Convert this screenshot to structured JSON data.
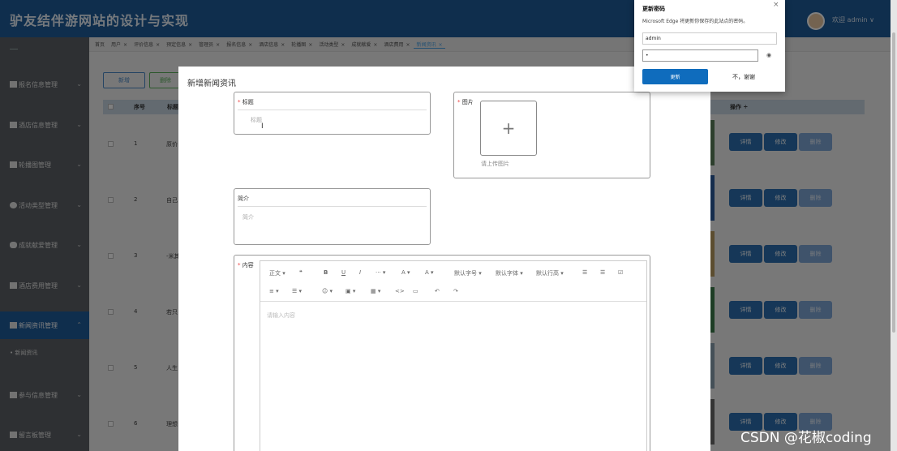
{
  "header": {
    "title": "驴友结伴游网站的设计与实现",
    "welcome": "欢迎 admin ∨"
  },
  "sidebar": {
    "items": [
      {
        "label": "报名信息管理"
      },
      {
        "label": "酒店信息管理"
      },
      {
        "label": "轮播图管理"
      },
      {
        "label": "活动类型管理"
      },
      {
        "label": "成就献爱管理"
      },
      {
        "label": "酒店费用管理"
      },
      {
        "label": "新闻资讯管理"
      },
      {
        "label": "参与信息管理"
      },
      {
        "label": "留言板管理"
      }
    ],
    "sub_item": "• 新闻资讯"
  },
  "tabs": [
    "首页",
    "用户",
    "评价信息",
    "预定信息",
    "管理员",
    "报名信息",
    "酒店信息",
    "轮播图",
    "活动类型",
    "成就献爱",
    "酒店费用",
    "新闻资讯"
  ],
  "toolbar": {
    "add": "新增",
    "delete": "删除"
  },
  "table": {
    "headers": {
      "no": "序号",
      "title": "标题",
      "op": "操作 ÷"
    },
    "rows": [
      {
        "no": "1",
        "title": "原价"
      },
      {
        "no": "2",
        "title": "自己"
      },
      {
        "no": "3",
        "title": "-米其"
      },
      {
        "no": "4",
        "title": "若只"
      },
      {
        "no": "5",
        "title": "人生"
      },
      {
        "no": "6",
        "title": "理想"
      }
    ],
    "ops": {
      "detail": "详情",
      "edit": "修改",
      "delete": "删除"
    }
  },
  "dialog": {
    "title": "新增新闻资讯",
    "title_label": "标题",
    "title_placeholder": "标题",
    "image_label": "图片",
    "upload_hint": "请上传图片",
    "intro_label": "简介",
    "intro_placeholder": "简介",
    "content_label": "内容",
    "editor_placeholder": "请输入内容",
    "editor_toolbar_row1": [
      "正文 ▾",
      "❝",
      "B",
      "U",
      "I",
      "··· ▾",
      "A ▾",
      "A ▾",
      "默认字号 ▾",
      "默认字体 ▾",
      "默认行高 ▾",
      "☰",
      "☰",
      "☑"
    ],
    "editor_toolbar_row2": [
      "≡ ▾",
      "☰ ▾",
      "☺ ▾",
      "▣ ▾",
      "▦ ▾",
      "<>",
      "▭",
      "↶",
      "↷"
    ]
  },
  "password_popup": {
    "title": "更新密码",
    "desc": "Microsoft Edge 将更新你保存的此站点的密码。",
    "username": "admin",
    "password": "•",
    "update": "更新",
    "no_thanks": "不，谢谢"
  },
  "watermark": "CSDN @花椒coding"
}
